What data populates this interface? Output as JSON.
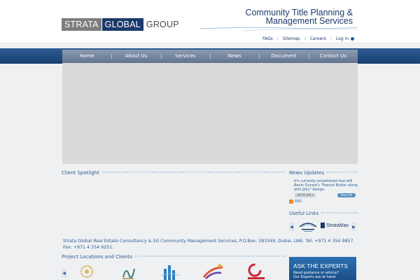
{
  "logo": {
    "part1": "STRATA",
    "part2": "GLOBAL",
    "part3": "GROUP"
  },
  "tagline": {
    "line1": "Community Title Planning &",
    "line2": "Management Services"
  },
  "top_links": [
    "FAQs",
    "Sitemap",
    "Careers",
    "Log in"
  ],
  "nav": [
    "Home",
    "About Us",
    "Services",
    "News",
    "Document Download",
    "Contact Us"
  ],
  "client_spotlight": {
    "title": "Client Spotlight"
  },
  "news": {
    "title": "News Updates",
    "text": "It's currently established that will Bevin Durant's \"Peanut Butter along with Jelly\" design.",
    "date": "20-01-2011",
    "read_all": "Read All"
  },
  "rss": "RSS",
  "useful_links": {
    "title": "Useful Links",
    "logo_b": "StrataMax"
  },
  "footer_address": "Strata Global Real Estate Consultancy & SG Community Management Services, P.O.Box: 283349, Dubai, UAE. Tel: +971 4 354 9857 Fax: +971 4 354 9251.",
  "projects": {
    "title": "Project Locations and Clients"
  },
  "ask": {
    "title": "ASK THE EXPERTS",
    "line1": "Need guidance or advice?",
    "line2": "Our Experts are at hand"
  },
  "colors": {
    "navy": "#1b3a6b",
    "nav_band": "#183f70",
    "link_blue": "#2d5c90",
    "banner_gray": "#d9d9d9"
  }
}
